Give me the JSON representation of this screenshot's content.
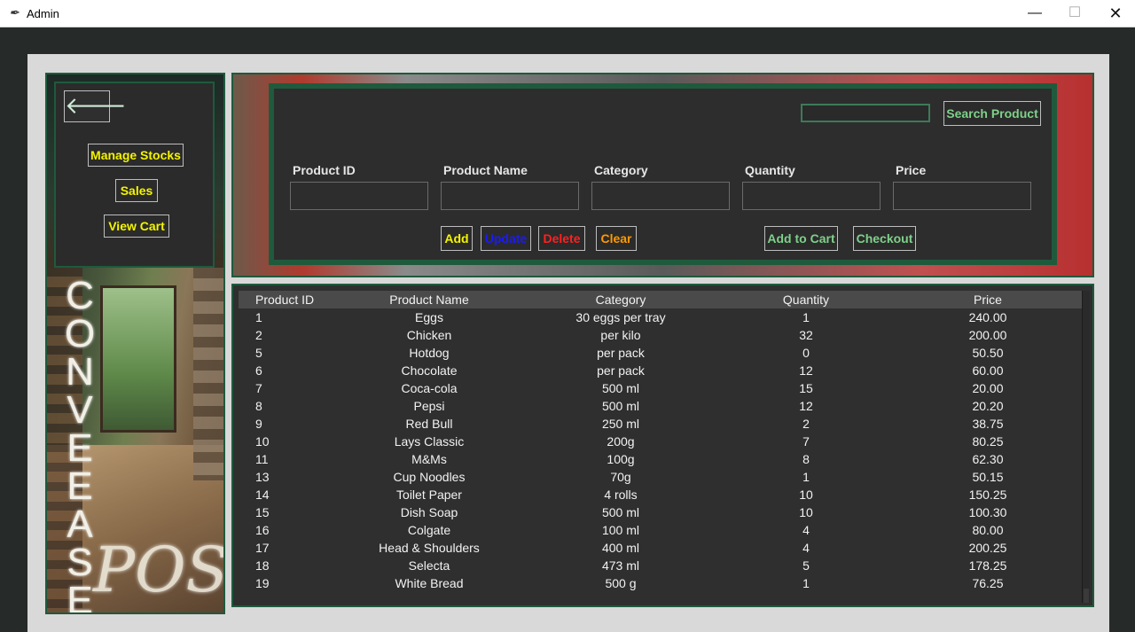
{
  "window": {
    "title": "Admin",
    "min_glyph": "—",
    "max_glyph": "☐",
    "close_glyph": "✕"
  },
  "sidebar": {
    "back_glyph": "🡐",
    "buttons": {
      "manage_stocks": "Manage Stocks",
      "sales": "Sales",
      "view_cart": "View Cart"
    },
    "brand_vertical": [
      "C",
      "O",
      "N",
      "V",
      "E",
      "E",
      "A",
      "S",
      "E"
    ],
    "brand_sign": "POS"
  },
  "form": {
    "search_value": "",
    "search_button": "Search Product",
    "labels": {
      "product_id": "Product ID",
      "product_name": "Product Name",
      "category": "Category",
      "quantity": "Quantity",
      "price": "Price"
    },
    "buttons": {
      "add": "Add",
      "update": "Update",
      "delete": "Delete",
      "clear": "Clear",
      "add_to_cart": "Add to Cart",
      "checkout": "Checkout"
    }
  },
  "table": {
    "columns": [
      "Product ID",
      "Product Name",
      "Category",
      "Quantity",
      "Price"
    ],
    "rows": [
      [
        "1",
        "Eggs",
        "30 eggs per tray",
        "1",
        "240.00"
      ],
      [
        "2",
        "Chicken",
        "per kilo",
        "32",
        "200.00"
      ],
      [
        "5",
        "Hotdog",
        "per pack",
        "0",
        "50.50"
      ],
      [
        "6",
        "Chocolate",
        "per pack",
        "12",
        "60.00"
      ],
      [
        "7",
        "Coca-cola",
        "500 ml",
        "15",
        "20.00"
      ],
      [
        "8",
        "Pepsi",
        "500 ml",
        "12",
        "20.20"
      ],
      [
        "9",
        "Red Bull",
        "250 ml",
        "2",
        "38.75"
      ],
      [
        "10",
        "Lays Classic",
        "200g",
        "7",
        "80.25"
      ],
      [
        "11",
        "M&Ms",
        "100g",
        "8",
        "62.30"
      ],
      [
        "13",
        "Cup Noodles",
        "70g",
        "1",
        "50.15"
      ],
      [
        "14",
        "Toilet Paper",
        "4 rolls",
        "10",
        "150.25"
      ],
      [
        "15",
        "Dish Soap",
        "500 ml",
        "10",
        "100.30"
      ],
      [
        "16",
        "Colgate",
        "100 ml",
        "4",
        "80.00"
      ],
      [
        "17",
        "Head & Shoulders",
        "400 ml",
        "4",
        "200.25"
      ],
      [
        "18",
        "Selecta",
        "473 ml",
        "5",
        "178.25"
      ],
      [
        "19",
        "White Bread",
        "500 g",
        "1",
        "76.25"
      ]
    ]
  },
  "colors": {
    "accent_green": "#1f5a3d",
    "nav_yellow": "#f4f400",
    "green_text": "#7fd08a",
    "update_blue": "#1a1aff",
    "delete_red": "#ff2020",
    "clear_orange": "#ff9900"
  }
}
